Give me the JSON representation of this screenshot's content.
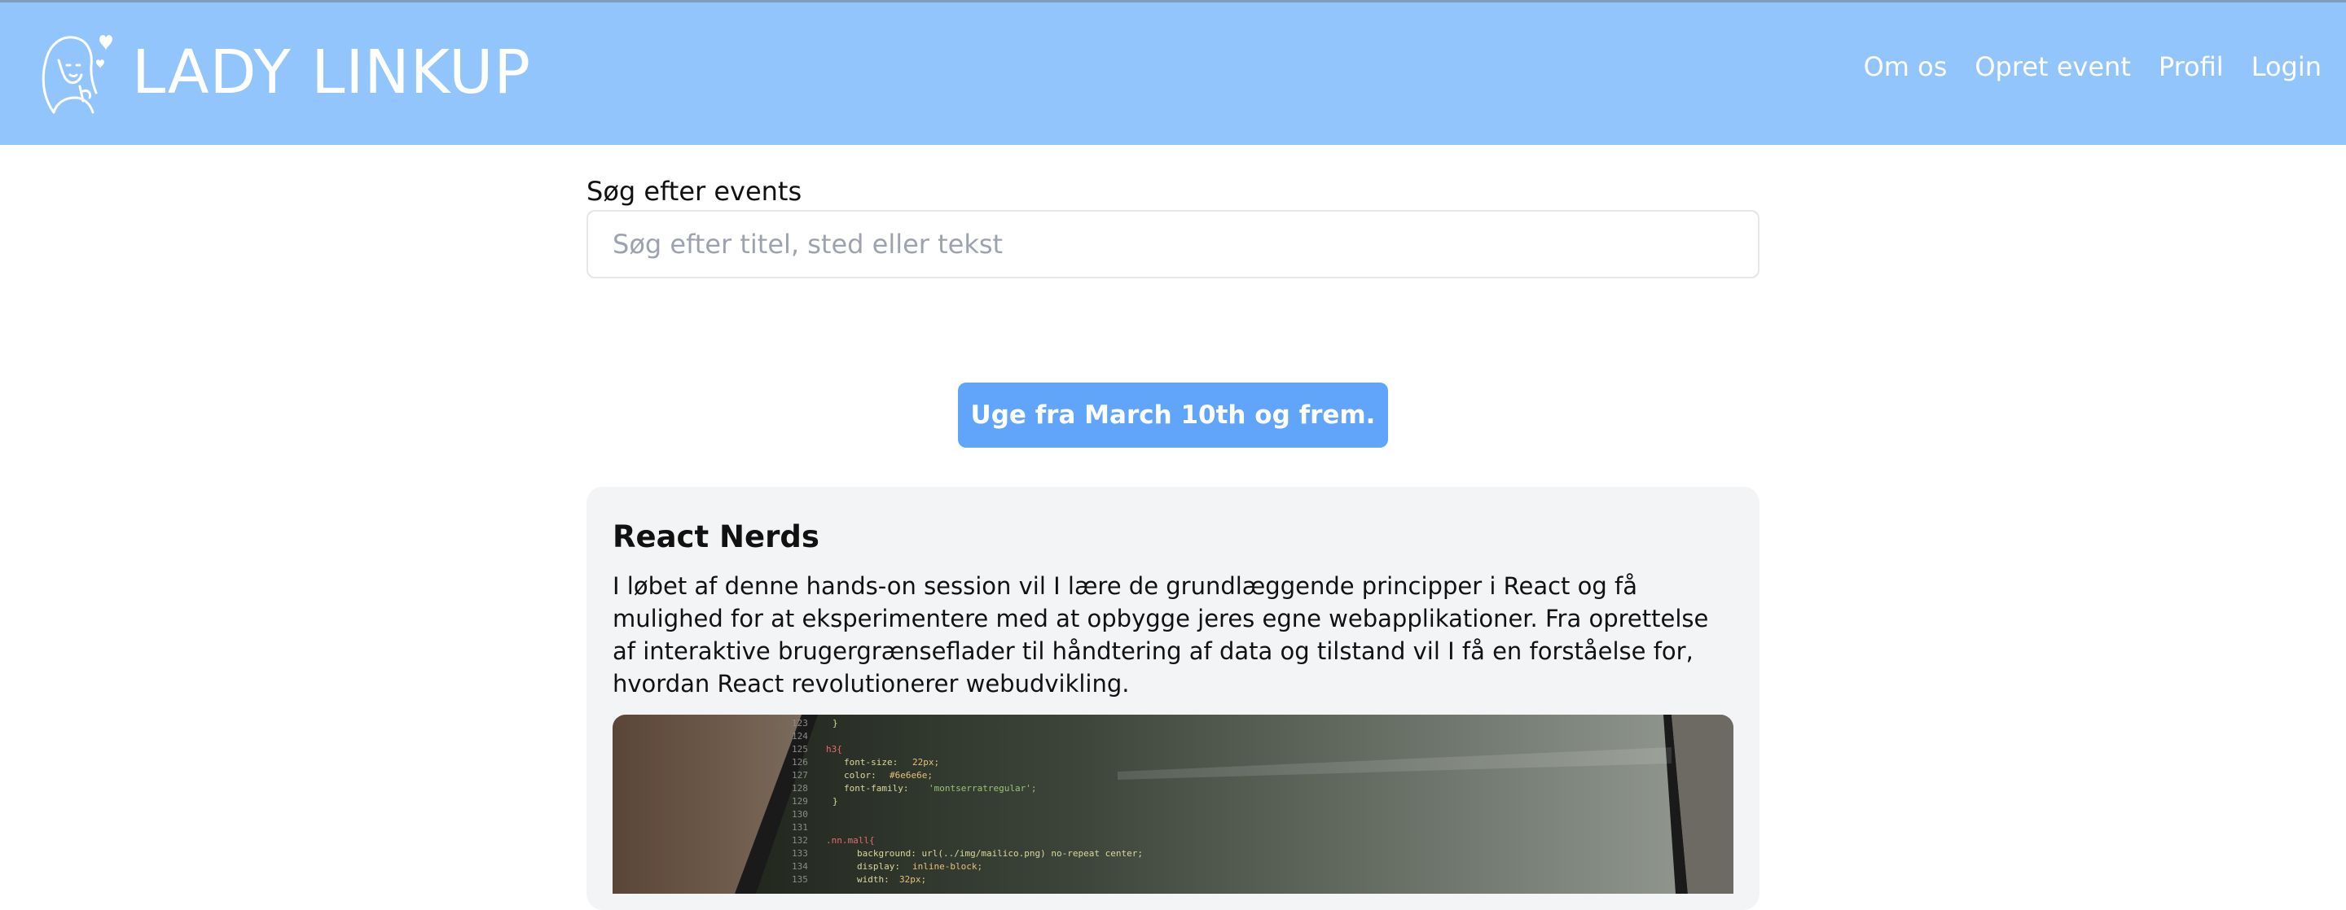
{
  "header": {
    "brand": "LADY LINKUP",
    "nav": [
      {
        "label": "Om os"
      },
      {
        "label": "Opret event"
      },
      {
        "label": "Profil"
      },
      {
        "label": "Login"
      }
    ],
    "background_color": "#93c5fd"
  },
  "search": {
    "label": "Søg efter events",
    "placeholder": "Søg efter titel, sted eller tekst",
    "value": ""
  },
  "week_button": {
    "label": "Uge fra March 10th og frem.",
    "color": "#60a5fa"
  },
  "events": [
    {
      "title": "React Nerds",
      "description": "I løbet af denne hands-on session vil I lære de grundlæggende principper i React og få mulighed for at eksperimentere med at opbygge jeres egne webapplikationer. Fra oprettelse af interaktive brugergrænseflader til håndtering af data og tilstand vil I få en forståelse for, hvordan React revolutionerer webudvikling.",
      "image": "laptop-code-photo"
    }
  ]
}
